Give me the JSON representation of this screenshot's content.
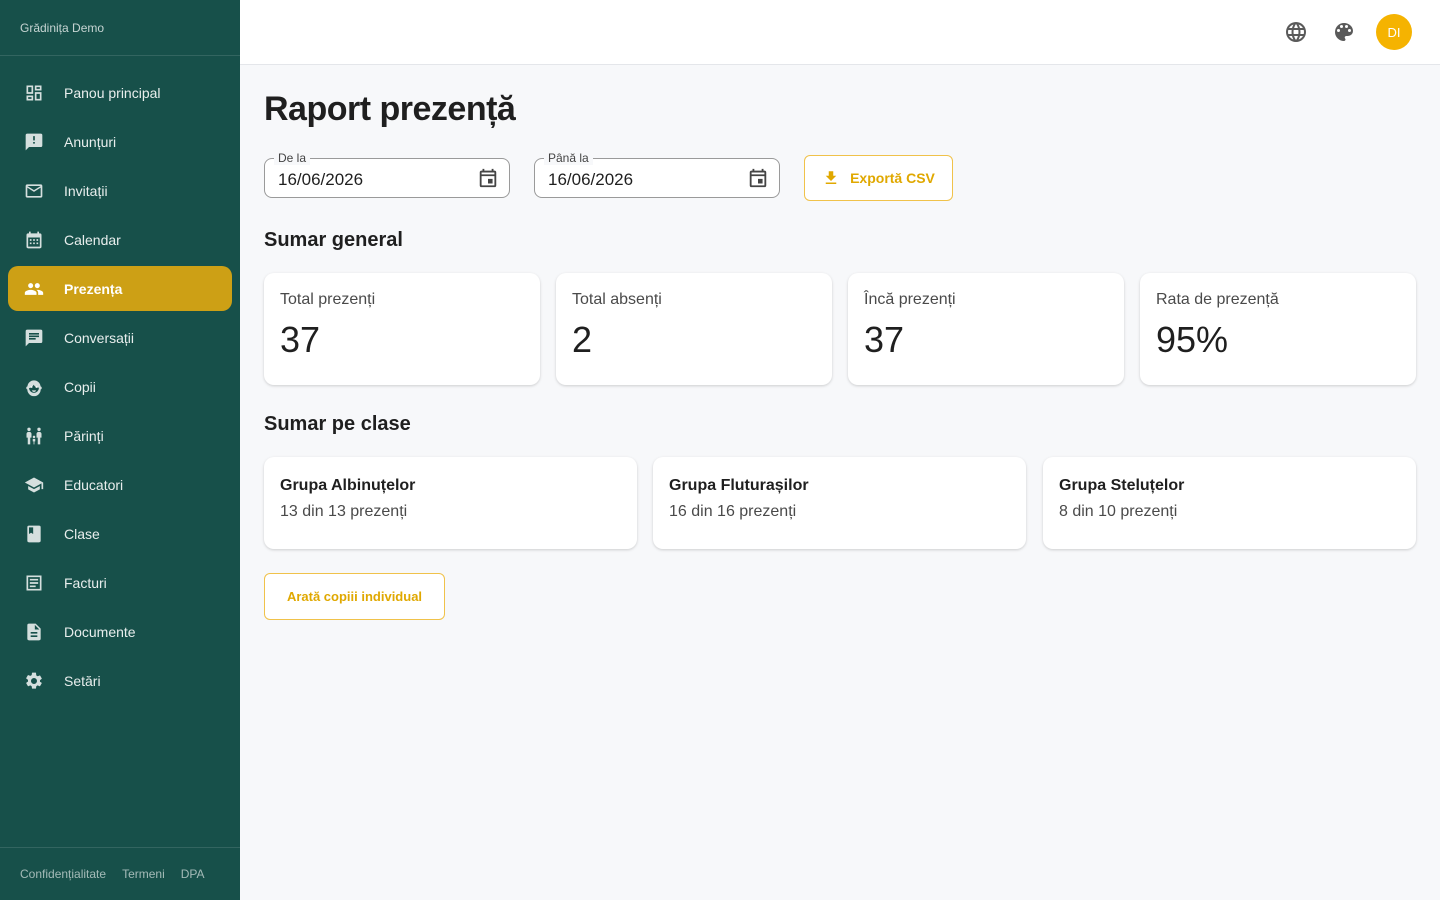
{
  "brand": {
    "name": "Grădinița Demo"
  },
  "sidebar": {
    "items": [
      {
        "label": "Panou principal",
        "icon": "dashboard-icon"
      },
      {
        "label": "Anunțuri",
        "icon": "announcement-icon"
      },
      {
        "label": "Invitații",
        "icon": "mail-icon"
      },
      {
        "label": "Calendar",
        "icon": "calendar-icon"
      },
      {
        "label": "Prezența",
        "icon": "people-icon",
        "active": true
      },
      {
        "label": "Conversații",
        "icon": "chat-icon"
      },
      {
        "label": "Copii",
        "icon": "child-face-icon"
      },
      {
        "label": "Părinți",
        "icon": "family-icon"
      },
      {
        "label": "Educatori",
        "icon": "school-icon"
      },
      {
        "label": "Clase",
        "icon": "book-icon"
      },
      {
        "label": "Facturi",
        "icon": "receipt-icon"
      },
      {
        "label": "Documente",
        "icon": "document-icon"
      },
      {
        "label": "Setări",
        "icon": "settings-icon"
      }
    ],
    "footer": {
      "privacy": "Confidențialitate",
      "terms": "Termeni",
      "dpa": "DPA"
    }
  },
  "topbar": {
    "language_icon": "globe-icon",
    "theme_icon": "palette-icon",
    "avatar_initials": "DI"
  },
  "page": {
    "title": "Raport prezență",
    "from": {
      "label": "De la",
      "value": "16/06/2026"
    },
    "to": {
      "label": "Până la",
      "value": "16/06/2026"
    },
    "export_label": "Exportă CSV",
    "summary_title": "Sumar general",
    "stats": [
      {
        "label": "Total prezenți",
        "value": "37"
      },
      {
        "label": "Total absenți",
        "value": "2"
      },
      {
        "label": "Încă prezenți",
        "value": "37"
      },
      {
        "label": "Rata de prezență",
        "value": "95%"
      }
    ],
    "classes_title": "Sumar pe clase",
    "classes": [
      {
        "name": "Grupa Albinuțelor",
        "detail": "13 din 13 prezenți"
      },
      {
        "name": "Grupa Fluturașilor",
        "detail": "16 din 16 prezenți"
      },
      {
        "name": "Grupa Steluțelor",
        "detail": "8 din 10 prezenți"
      }
    ],
    "show_children_label": "Arată copiii individual"
  },
  "colors": {
    "sidebar": "#17504a",
    "active": "#cda015",
    "accent": "#f5b301"
  }
}
